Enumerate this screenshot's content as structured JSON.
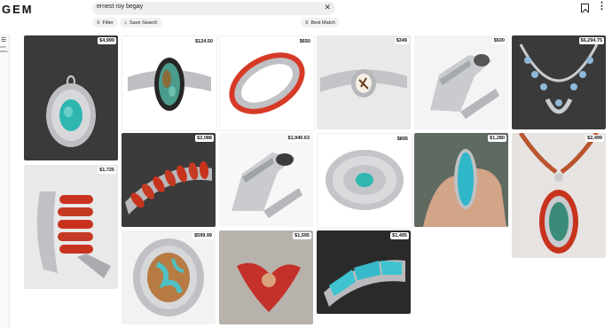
{
  "header": {
    "logo": "GEM",
    "search_value": "ernest roy begay",
    "filter_label": "Filter",
    "save_search_label": "Save Search",
    "sort_label": "Best Match"
  },
  "sidebar": {
    "label_line1": "ved",
    "label_line2": "ches"
  },
  "items": [
    {
      "price": "$4,999"
    },
    {
      "price": "$124.50"
    },
    {
      "price": "$650"
    },
    {
      "price": "$349"
    },
    {
      "price": "$500"
    },
    {
      "price": "$6,294.75"
    },
    {
      "price": "$1,725"
    },
    {
      "price": "$2,088"
    },
    {
      "price": "$1,940.63"
    },
    {
      "price": "$895"
    },
    {
      "price": "$1,280"
    },
    {
      "price": "$2,499"
    },
    {
      "price": "$599.99"
    },
    {
      "price": "$1,595"
    },
    {
      "price": "$1,495"
    }
  ],
  "colors": {
    "turquoise": "#2fb6b1",
    "coral": "#c8331e",
    "silver": "#c9cbcf"
  }
}
